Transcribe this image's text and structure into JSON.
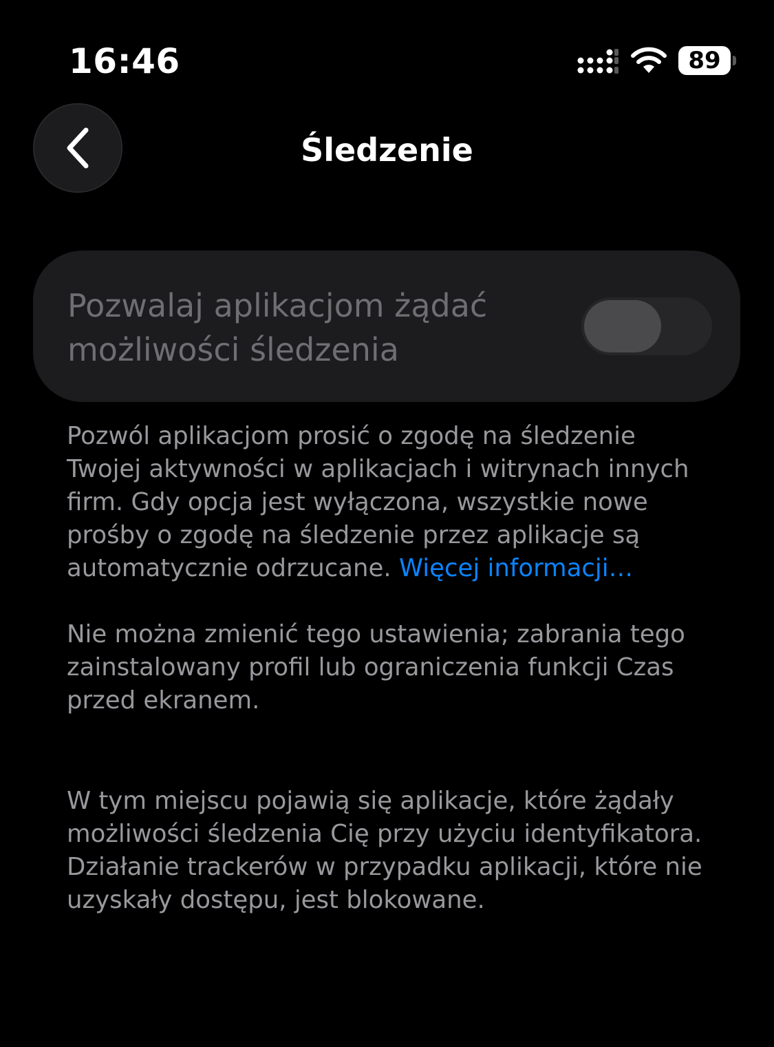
{
  "status_bar": {
    "time": "16:46",
    "battery_level": "89",
    "icons": [
      "cellular-signal-icon",
      "wifi-icon",
      "battery-icon"
    ]
  },
  "header": {
    "title": "Śledzenie",
    "back_icon": "chevron-left-icon"
  },
  "toggle": {
    "label": "Pozwalaj aplikacjom żądać możliwości śledzenia",
    "state": "off",
    "enabled": false
  },
  "footer": {
    "description": "Pozwól aplikacjom prosić o zgodę na śledzenie Twojej aktywności w aplikacjach i witrynach innych firm. Gdy opcja jest wyłączona, wszystkie nowe prośby o zgodę na śledzenie przez aplikacje są automatycznie odrzucane. ",
    "link": "Więcej informacji…",
    "restriction_note": "Nie można zmienić tego ustawienia; zabrania tego zainstalowany profil lub ograniczenia funkcji Czas przed ekranem.",
    "apps_note": "W tym miejscu pojawią się aplikacje, które żądały możliwości śledzenia Cię przy użyciu identyfikatora. Działanie trackerów w przypadku aplikacji, które nie uzyskały dostępu, jest blokowane."
  },
  "colors": {
    "background": "#000000",
    "card": "#1c1c1e",
    "secondary_text": "#98989d",
    "disabled_text": "#6e6e73",
    "link": "#0a84ff"
  }
}
